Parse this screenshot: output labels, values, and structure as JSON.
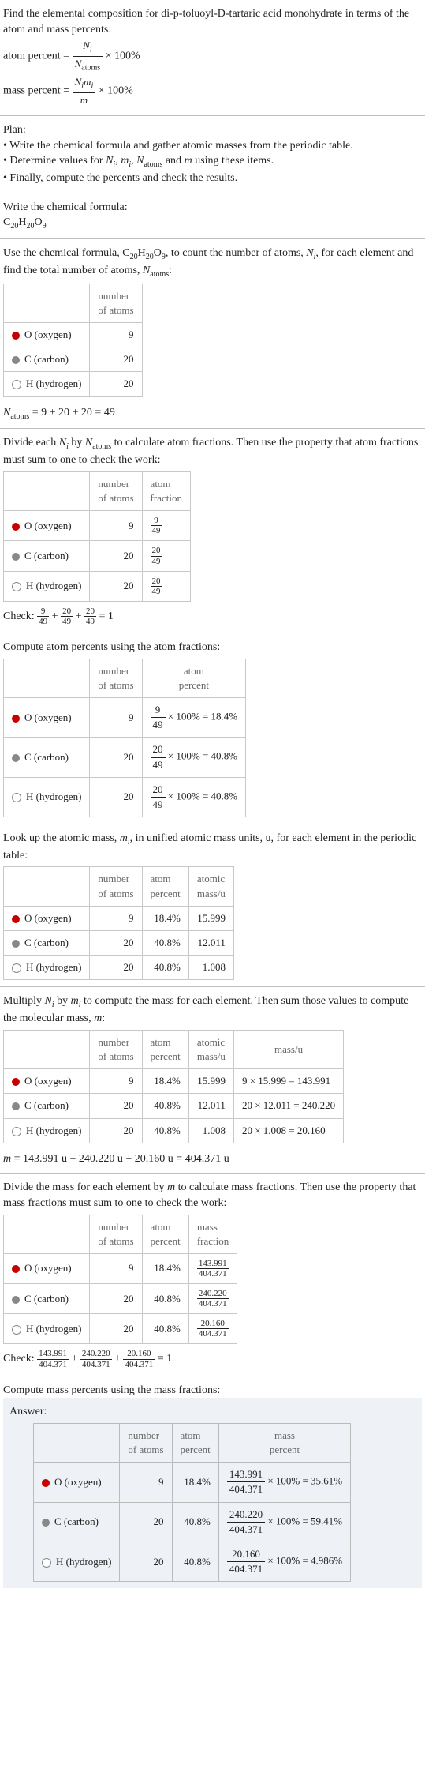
{
  "intro": {
    "heading": "Find the elemental composition for di-p-toluoyl-D-tartaric acid monohydrate in terms of the atom and mass percents:",
    "atom_pct_label": "atom percent =",
    "atom_num": "N",
    "atom_sub": "i",
    "atom_den": "N",
    "atom_den_sub": "atoms",
    "times100": " × 100%",
    "mass_pct_label": "mass percent =",
    "mass_num1": "N",
    "mass_num1_sub": "i",
    "mass_num2": "m",
    "mass_num2_sub": "i",
    "mass_den": "m"
  },
  "plan": {
    "label": "Plan:",
    "b1": "• Write the chemical formula and gather atomic masses from the periodic table.",
    "b2_a": "• Determine values for ",
    "b2_n": "N",
    "b2_sub_i": "i",
    "b2_sep1": ", ",
    "b2_m": "m",
    "b2_sep2": ", ",
    "b2_na": "N",
    "b2_sub_atoms": "atoms",
    "b2_and": " and ",
    "b2_m2": "m",
    "b2_tail": " using these items.",
    "b3": "• Finally, compute the percents and check the results."
  },
  "formula_sec": {
    "heading": "Write the chemical formula:",
    "prefix": "C",
    "c": "20",
    "h": "H",
    "hn": "20",
    "o": "O",
    "on": "9"
  },
  "count_sec": {
    "heading_a": "Use the chemical formula, ",
    "heading_b": ", to count the number of atoms, ",
    "heading_c": ", for each element and find the total number of atoms, ",
    "heading_d": ":",
    "col1": "",
    "col2_l1": "number",
    "col2_l2": "of atoms",
    "rows": [
      {
        "el": "O (oxygen)",
        "n": "9"
      },
      {
        "el": "C (carbon)",
        "n": "20"
      },
      {
        "el": "H (hydrogen)",
        "n": "20"
      }
    ],
    "sum_lhs": "N",
    "sum_sub": "atoms",
    "sum_eq": " = 9 + 20 + 20 = 49"
  },
  "frac_sec": {
    "heading_a": "Divide each ",
    "heading_b": " by ",
    "heading_c": " to calculate atom fractions. Then use the property that atom fractions must sum to one to check the work:",
    "col3_l1": "atom",
    "col3_l2": "fraction",
    "rows": [
      {
        "el": "O (oxygen)",
        "n": "9",
        "fn": "9",
        "fd": "49"
      },
      {
        "el": "C (carbon)",
        "n": "20",
        "fn": "20",
        "fd": "49"
      },
      {
        "el": "H (hydrogen)",
        "n": "20",
        "fn": "20",
        "fd": "49"
      }
    ],
    "check_label": "Check: ",
    "check_plus": " + ",
    "check_eq": " = 1"
  },
  "atom_pct_sec": {
    "heading": "Compute atom percents using the atom fractions:",
    "col3_l1": "atom",
    "col3_l2": "percent",
    "rows": [
      {
        "el": "O (oxygen)",
        "n": "9",
        "fn": "9",
        "fd": "49",
        "r": " × 100% = 18.4%"
      },
      {
        "el": "C (carbon)",
        "n": "20",
        "fn": "20",
        "fd": "49",
        "r": " × 100% = 40.8%"
      },
      {
        "el": "H (hydrogen)",
        "n": "20",
        "fn": "20",
        "fd": "49",
        "r": " × 100% = 40.8%"
      }
    ]
  },
  "atomic_mass_sec": {
    "heading_a": "Look up the atomic mass, ",
    "heading_b": ", in unified atomic mass units, u, for each element in the periodic table:",
    "col3_l1": "atom",
    "col3_l2": "percent",
    "col4_l1": "atomic",
    "col4_l2": "mass/u",
    "rows": [
      {
        "el": "O (oxygen)",
        "n": "9",
        "ap": "18.4%",
        "am": "15.999"
      },
      {
        "el": "C (carbon)",
        "n": "20",
        "ap": "40.8%",
        "am": "12.011"
      },
      {
        "el": "H (hydrogen)",
        "n": "20",
        "ap": "40.8%",
        "am": "1.008"
      }
    ]
  },
  "mass_sec": {
    "heading_a": "Multiply ",
    "heading_b": " by ",
    "heading_c": " to compute the mass for each element. Then sum those values to compute the molecular mass, ",
    "heading_d": ":",
    "col5": "mass/u",
    "rows": [
      {
        "el": "O (oxygen)",
        "n": "9",
        "ap": "18.4%",
        "am": "15.999",
        "mu": "9 × 15.999 = 143.991"
      },
      {
        "el": "C (carbon)",
        "n": "20",
        "ap": "40.8%",
        "am": "12.011",
        "mu": "20 × 12.011 = 240.220"
      },
      {
        "el": "H (hydrogen)",
        "n": "20",
        "ap": "40.8%",
        "am": "1.008",
        "mu": "20 × 1.008 = 20.160"
      }
    ],
    "m_eq": " = 143.991 u + 240.220 u + 20.160 u = 404.371 u"
  },
  "mass_frac_sec": {
    "heading_a": "Divide the mass for each element by ",
    "heading_b": " to calculate mass fractions. Then use the property that mass fractions must sum to one to check the work:",
    "col4_l1": "mass",
    "col4_l2": "fraction",
    "rows": [
      {
        "el": "O (oxygen)",
        "n": "9",
        "ap": "18.4%",
        "fn": "143.991",
        "fd": "404.371"
      },
      {
        "el": "C (carbon)",
        "n": "20",
        "ap": "40.8%",
        "fn": "240.220",
        "fd": "404.371"
      },
      {
        "el": "H (hydrogen)",
        "n": "20",
        "ap": "40.8%",
        "fn": "20.160",
        "fd": "404.371"
      }
    ],
    "check_label": "Check: ",
    "check_plus": " + ",
    "check_eq": " = 1",
    "cf": [
      {
        "n": "143.991",
        "d": "404.371"
      },
      {
        "n": "240.220",
        "d": "404.371"
      },
      {
        "n": "20.160",
        "d": "404.371"
      }
    ]
  },
  "final_sec": {
    "heading": "Compute mass percents using the mass fractions:",
    "answer_label": "Answer:",
    "col3_l1": "atom",
    "col3_l2": "percent",
    "col4_l1": "mass",
    "col4_l2": "percent",
    "rows": [
      {
        "el": "O (oxygen)",
        "n": "9",
        "ap": "18.4%",
        "fn": "143.991",
        "fd": "404.371",
        "r": " × 100% = 35.61%"
      },
      {
        "el": "C (carbon)",
        "n": "20",
        "ap": "40.8%",
        "fn": "240.220",
        "fd": "404.371",
        "r": " × 100% = 59.41%"
      },
      {
        "el": "H (hydrogen)",
        "n": "20",
        "ap": "40.8%",
        "fn": "20.160",
        "fd": "404.371",
        "r": " × 100% = 4.986%"
      }
    ]
  }
}
